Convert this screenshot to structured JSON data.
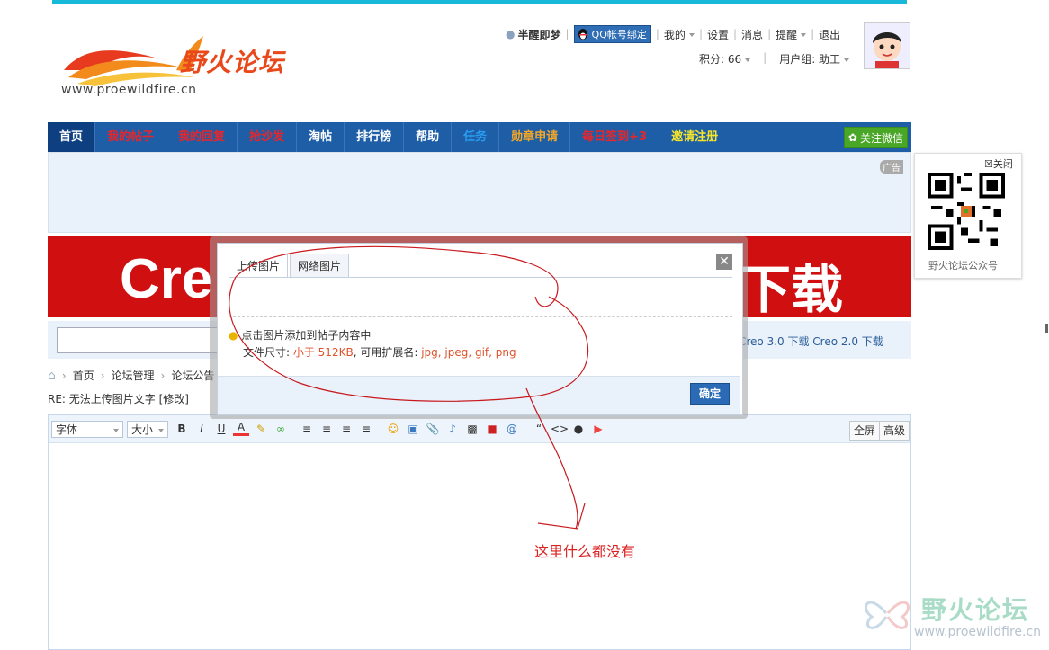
{
  "site": {
    "logo_name": "野火论坛",
    "logo_url": "www.proewildfire.cn"
  },
  "userbar": {
    "username": "半醒即梦",
    "qq_bind": "QQ帐号绑定",
    "my": "我的",
    "settings": "设置",
    "messages": "消息",
    "remind": "提醒",
    "logout": "退出",
    "points": "积分: 66",
    "group": "用户组: 助工"
  },
  "nav": {
    "tabs": [
      {
        "label": "首页",
        "color": "#ffffff"
      },
      {
        "label": "我的帖子",
        "color": "#e8262a"
      },
      {
        "label": "我的回复",
        "color": "#e8262a"
      },
      {
        "label": "抢沙发",
        "color": "#e8262a"
      },
      {
        "label": "淘帖",
        "color": "#ffffff"
      },
      {
        "label": "排行榜",
        "color": "#ffffff"
      },
      {
        "label": "帮助",
        "color": "#ffffff"
      },
      {
        "label": "任务",
        "color": "#2a9cf0"
      },
      {
        "label": "勋章申请",
        "color": "#f5a623"
      },
      {
        "label": "每日签到+3",
        "color": "#e8262a"
      },
      {
        "label": "邀请注册",
        "color": "#f7e52a"
      }
    ],
    "wechat": "关注微信"
  },
  "ad": {
    "tag": "广告",
    "banner_left": "Cre",
    "banner_right": "下载"
  },
  "search": {
    "links": "Creo 3.0 下载   Creo 2.0 下载"
  },
  "breadcrumb": {
    "home": "首页",
    "level1": "论坛管理",
    "level2": "论坛公告"
  },
  "reply_title": "RE: 无法上传图片文字 [修改]",
  "editor": {
    "font": "字体",
    "size": "大小",
    "fullscreen": "全屏",
    "advanced": "高级"
  },
  "qr": {
    "close": "关闭",
    "caption": "野火论坛公众号"
  },
  "modal": {
    "tab_upload": "上传图片",
    "tab_web": "网络图片",
    "hint": "点击图片添加到帖子内容中",
    "size_label": "文件尺寸: ",
    "size_value": "小于 512KB",
    "ext_label": ", 可用扩展名: ",
    "ext_value": "jpg, jpeg, gif, png",
    "ok": "确定"
  },
  "annotation": {
    "text": "这里什么都没有"
  },
  "watermark": {
    "text": "野火论坛",
    "url": "www.proewildfire.cn"
  }
}
